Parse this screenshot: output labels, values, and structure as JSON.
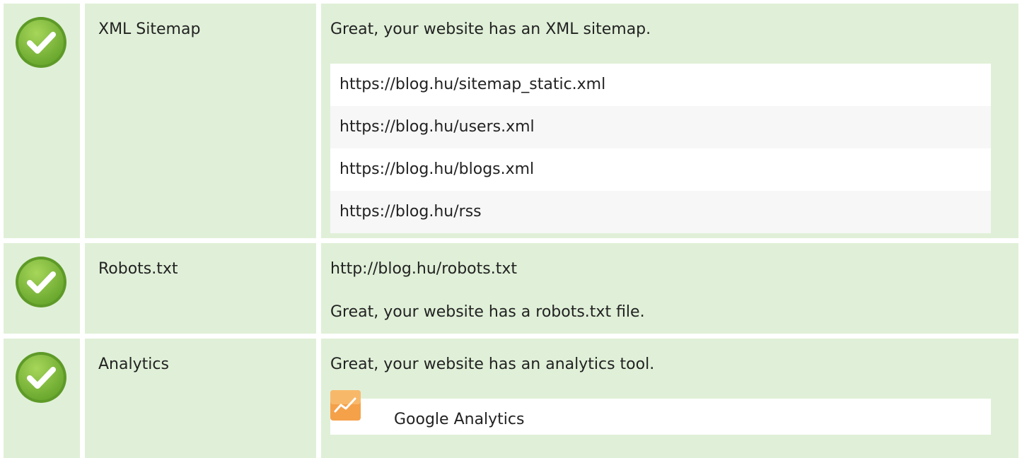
{
  "rows": [
    {
      "label": "XML Sitemap",
      "status_icon": "check-icon",
      "message": "Great, your website has an XML sitemap.",
      "urls": [
        "https://blog.hu/sitemap_static.xml",
        "https://blog.hu/users.xml",
        "https://blog.hu/blogs.xml",
        "https://blog.hu/rss"
      ]
    },
    {
      "label": "Robots.txt",
      "status_icon": "check-icon",
      "url": "http://blog.hu/robots.txt",
      "message": "Great, your website has a robots.txt file."
    },
    {
      "label": "Analytics",
      "status_icon": "check-icon",
      "message": "Great, your website has an analytics tool.",
      "tool": {
        "name": "Google Analytics",
        "icon": "google-analytics-icon"
      }
    }
  ],
  "colors": {
    "row_bg": "#e0f0d8",
    "check_green": "#7ab93b",
    "alt_row": "#f7f7f7",
    "ga_orange": "#f5a14a"
  }
}
